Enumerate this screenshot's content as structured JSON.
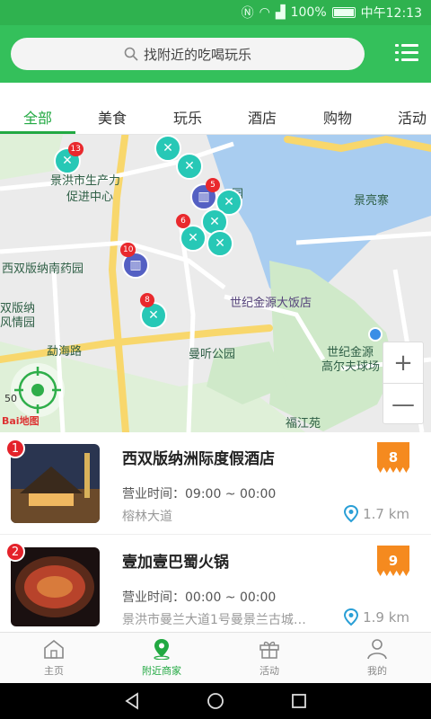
{
  "status_bar": {
    "battery": "100%",
    "time": "中午12:13"
  },
  "search": {
    "placeholder": "找附近的吃喝玩乐",
    "icon": "search-icon"
  },
  "tabs": [
    {
      "label": "全部",
      "active": true
    },
    {
      "label": "美食"
    },
    {
      "label": "玩乐"
    },
    {
      "label": "酒店"
    },
    {
      "label": "购物"
    },
    {
      "label": "活动"
    }
  ],
  "map": {
    "labels": {
      "productivity_center_1": "景洪市生产力",
      "productivity_center_2": "促进中心",
      "jingliang": "景亮寨",
      "botanical_garden": "西双版纳南药园",
      "banna_1": "双版纳",
      "banna_2": "风情园",
      "century_hotel": "世纪金源大饭店",
      "menghai_road": "勐海路",
      "mangting_park": "曼听公园",
      "golf_1": "世纪金源",
      "golf_2": "高尔夫球场",
      "fujiang": "福江苑",
      "yuan": "园"
    },
    "pins": [
      {
        "count": "13",
        "kind": "food"
      },
      {
        "count": "5",
        "kind": "hotel"
      },
      {
        "count": "6",
        "kind": "food"
      },
      {
        "count": "10",
        "kind": "hotel"
      },
      {
        "count": "8",
        "kind": "food"
      }
    ],
    "zoom_in": "+",
    "zoom_out": "—",
    "scale": "50",
    "baidu_logo": "Bai地图"
  },
  "merchants": [
    {
      "rank": "1",
      "name": "西双版纳洲际度假酒店",
      "hours": "营业时间：09:00 ~ 00:00",
      "address": "榕林大道",
      "distance": "1.7 km",
      "score": "8"
    },
    {
      "rank": "2",
      "name": "壹加壹巴蜀火锅",
      "hours": "营业时间：00:00 ~ 00:00",
      "address": "景洪市曼兰大道1号曼景兰古城…",
      "distance": "1.9 km",
      "score": "9"
    }
  ],
  "bottom_nav": [
    {
      "label": "主页",
      "icon": "home-icon"
    },
    {
      "label": "附近商家",
      "icon": "location-icon",
      "active": true
    },
    {
      "label": "活动",
      "icon": "gift-icon"
    },
    {
      "label": "我的",
      "icon": "user-icon"
    }
  ],
  "colors": {
    "brand": "#34c05b",
    "accent": "#22a942",
    "score": "#f58a1f",
    "rank": "#e4222a"
  }
}
